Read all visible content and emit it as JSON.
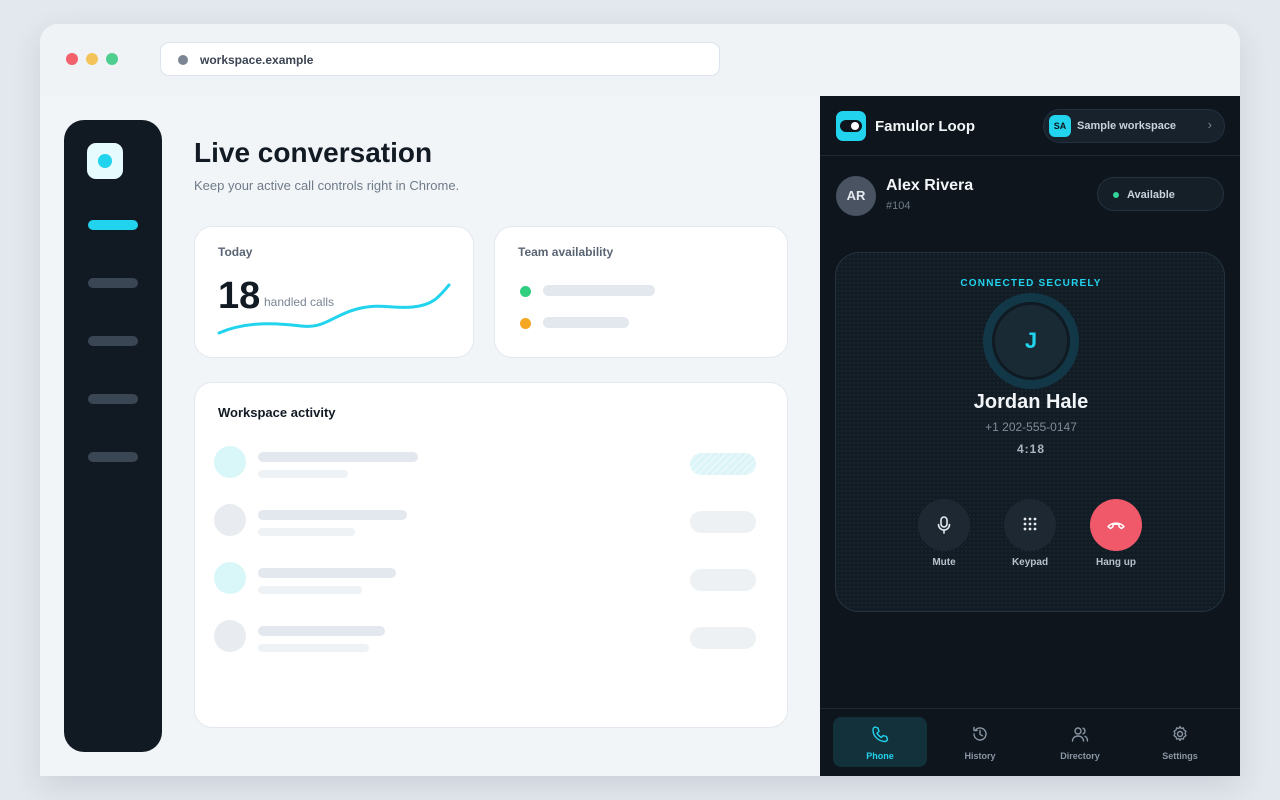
{
  "browser": {
    "url": "workspace.example"
  },
  "page": {
    "title": "Live conversation",
    "subtitle": "Keep your active call controls right in Chrome."
  },
  "stats": {
    "today_label": "Today",
    "calls_count": "18",
    "calls_unit": "handled calls"
  },
  "team": {
    "label": "Team availability"
  },
  "activity": {
    "title": "Workspace activity"
  },
  "extension": {
    "brand": "Famulor Loop",
    "workspace_avatar": "SA",
    "workspace_label": "Sample workspace",
    "workspace_chevron": "›",
    "user": {
      "initials": "AR",
      "name": "Alex Rivera",
      "ext": "#104"
    },
    "availability": "Available",
    "call": {
      "status": "CONNECTED SECURELY",
      "caller_initial": "J",
      "caller_name": "Jordan Hale",
      "caller_number": "+1 202-555-0147",
      "duration": "4:18"
    },
    "controls": [
      {
        "label": "Mute",
        "icon": "microphone-icon"
      },
      {
        "label": "Keypad",
        "icon": "keypad-icon"
      },
      {
        "label": "Hang up",
        "icon": "hang-up-icon"
      }
    ],
    "tabs": [
      {
        "label": "Phone",
        "icon": "phone-icon",
        "active": true
      },
      {
        "label": "History",
        "icon": "history-icon",
        "active": false
      },
      {
        "label": "Directory",
        "icon": "directory-icon",
        "active": false
      },
      {
        "label": "Settings",
        "icon": "gear-icon",
        "active": false
      }
    ]
  },
  "colors": {
    "accent": "#22d3ee",
    "panel_bg": "#0e151c",
    "hang_up": "#f0596a",
    "available": "#34d399",
    "away": "#f5a623"
  }
}
